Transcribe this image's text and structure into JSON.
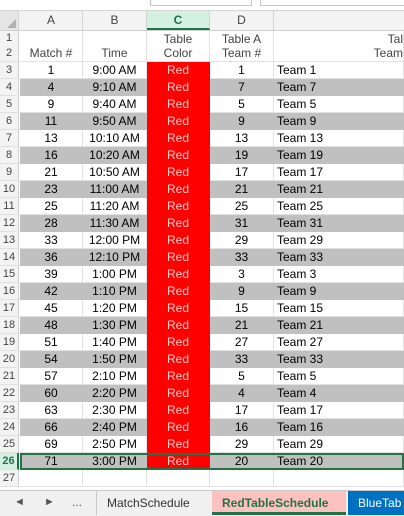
{
  "columns": [
    "A",
    "B",
    "C",
    "D",
    ""
  ],
  "selected_column": "C",
  "selected_row": "26",
  "header_row1": {
    "row": "1",
    "c": "Table",
    "d": "Table A",
    "e": "Tal"
  },
  "header_row2": {
    "row": "2",
    "a": "Match #",
    "b": "Time",
    "c": "Color",
    "d": "Team #",
    "e": "Team"
  },
  "color_label": "Red",
  "rows": [
    {
      "row": "3",
      "match": "1",
      "time": "9:00 AM",
      "team_num": "1",
      "team": "Team 1"
    },
    {
      "row": "4",
      "match": "4",
      "time": "9:10 AM",
      "team_num": "7",
      "team": "Team 7"
    },
    {
      "row": "5",
      "match": "9",
      "time": "9:40 AM",
      "team_num": "5",
      "team": "Team 5"
    },
    {
      "row": "6",
      "match": "11",
      "time": "9:50 AM",
      "team_num": "9",
      "team": "Team 9"
    },
    {
      "row": "7",
      "match": "13",
      "time": "10:10 AM",
      "team_num": "13",
      "team": "Team 13"
    },
    {
      "row": "8",
      "match": "16",
      "time": "10:20 AM",
      "team_num": "19",
      "team": "Team 19"
    },
    {
      "row": "9",
      "match": "21",
      "time": "10:50 AM",
      "team_num": "17",
      "team": "Team 17"
    },
    {
      "row": "10",
      "match": "23",
      "time": "11:00 AM",
      "team_num": "21",
      "team": "Team 21"
    },
    {
      "row": "11",
      "match": "25",
      "time": "11:20 AM",
      "team_num": "25",
      "team": "Team 25"
    },
    {
      "row": "12",
      "match": "28",
      "time": "11:30 AM",
      "team_num": "31",
      "team": "Team 31"
    },
    {
      "row": "13",
      "match": "33",
      "time": "12:00 PM",
      "team_num": "29",
      "team": "Team 29"
    },
    {
      "row": "14",
      "match": "36",
      "time": "12:10 PM",
      "team_num": "33",
      "team": "Team 33"
    },
    {
      "row": "15",
      "match": "39",
      "time": "1:00 PM",
      "team_num": "3",
      "team": "Team 3"
    },
    {
      "row": "16",
      "match": "42",
      "time": "1:10 PM",
      "team_num": "9",
      "team": "Team 9"
    },
    {
      "row": "17",
      "match": "45",
      "time": "1:20 PM",
      "team_num": "15",
      "team": "Team 15"
    },
    {
      "row": "18",
      "match": "48",
      "time": "1:30 PM",
      "team_num": "21",
      "team": "Team 21"
    },
    {
      "row": "19",
      "match": "51",
      "time": "1:40 PM",
      "team_num": "27",
      "team": "Team 27"
    },
    {
      "row": "20",
      "match": "54",
      "time": "1:50 PM",
      "team_num": "33",
      "team": "Team 33"
    },
    {
      "row": "21",
      "match": "57",
      "time": "2:10 PM",
      "team_num": "5",
      "team": "Team 5"
    },
    {
      "row": "22",
      "match": "60",
      "time": "2:20 PM",
      "team_num": "4",
      "team": "Team 4"
    },
    {
      "row": "23",
      "match": "63",
      "time": "2:30 PM",
      "team_num": "17",
      "team": "Team 17"
    },
    {
      "row": "24",
      "match": "66",
      "time": "2:40 PM",
      "team_num": "16",
      "team": "Team 16"
    },
    {
      "row": "25",
      "match": "69",
      "time": "2:50 PM",
      "team_num": "29",
      "team": "Team 29"
    },
    {
      "row": "26",
      "match": "71",
      "time": "3:00 PM",
      "team_num": "20",
      "team": "Team 20"
    }
  ],
  "empty_row": "27",
  "tabs": {
    "nav_prev": "◄",
    "nav_next": "►",
    "more": "...",
    "items": [
      "MatchSchedule",
      "RedTableSchedule",
      "BlueTab"
    ],
    "active": "RedTableSchedule"
  },
  "colors": {
    "red": "#ff0000",
    "shade": "#c0c0c0",
    "accent": "#217346",
    "blue_tab": "#0070c0",
    "active_tab": "#ffc0c0"
  }
}
